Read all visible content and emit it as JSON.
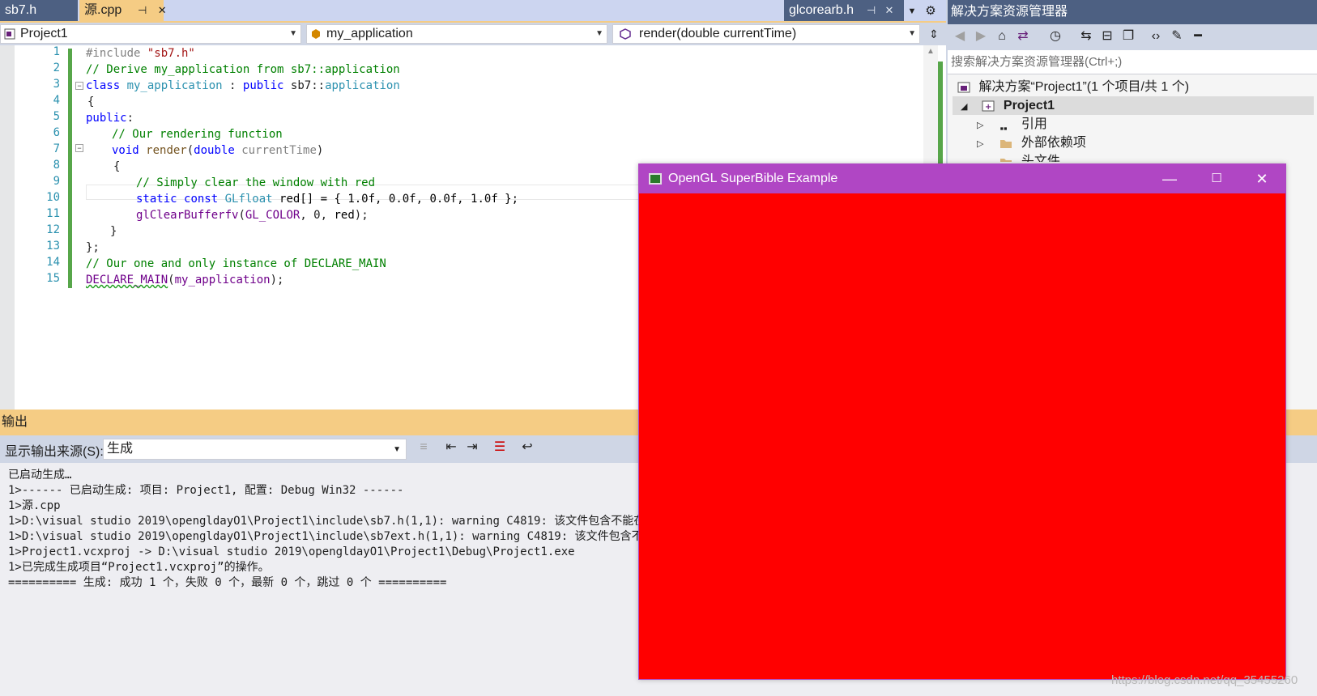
{
  "editor_tabs": {
    "tab1": "sb7.h",
    "tab2": "源.cpp",
    "tab3": "glcorearb.h"
  },
  "navbar": {
    "project": "Project1",
    "scope": "my_application",
    "member": "render(double currentTime)"
  },
  "code": {
    "line_numbers": [
      "1",
      "2",
      "3",
      "4",
      "5",
      "6",
      "7",
      "8",
      "9",
      "10",
      "11",
      "12",
      "13",
      "14",
      "15"
    ],
    "l1_directive": "#include ",
    "l1_string": "\"sb7.h\"",
    "l2": "// Derive my_application from sb7::application",
    "l3_kw": "class ",
    "l3_cls": "my_application",
    "l3_sep": " : ",
    "l3_pub": "public ",
    "l3_ns": "sb7::",
    "l3_base": "application",
    "l4": "{",
    "l5_kw": "public",
    "l5_colon": ":",
    "l6": "// Our rendering function",
    "l7_void": "void ",
    "l7_fn": "render",
    "l7_open": "(",
    "l7_double": "double ",
    "l7_param": "currentTime",
    "l7_close": ")",
    "l8": "{",
    "l9": "// Simply clear the window with red",
    "l10_static": "static ",
    "l10_const": "const ",
    "l10_type": "GLfloat ",
    "l10_rest": "red[] = { 1.0f, 0.0f, 0.0f, 1.0f };",
    "l11_fn": "glClearBufferfv",
    "l11_open": "(",
    "l11_macro": "GL_COLOR",
    "l11_mid": ", 0, ",
    "l11_red": "red",
    "l11_end": ");",
    "l12": "}",
    "l13": "};",
    "l14": "// Our one and only instance of DECLARE_MAIN",
    "l15_macro": "DECLARE_MAIN",
    "l15_open": "(",
    "l15_arg": "my_application",
    "l15_end": ");"
  },
  "solution_explorer": {
    "title": "解决方案资源管理器",
    "search_placeholder": "搜索解决方案资源管理器(Ctrl+;)",
    "solution": "解决方案“Project1”(1 个项目/共 1 个)",
    "project": "Project1",
    "references": "引用",
    "external_deps": "外部依赖项",
    "header_files": "头文件"
  },
  "output": {
    "title": "输出",
    "source_label": "显示输出来源(S):",
    "source_value": "生成",
    "lines": [
      "已启动生成…",
      "1>------ 已启动生成: 项目: Project1, 配置: Debug Win32 ------",
      "1>源.cpp",
      "1>D:\\visual studio 2019\\opengldayO1\\Project1\\include\\sb7.h(1,1): warning C4819: 该文件包含不能在当",
      "1>D:\\visual studio 2019\\opengldayO1\\Project1\\include\\sb7ext.h(1,1): warning C4819: 该文件包含不能在",
      "1>Project1.vcxproj -> D:\\visual studio 2019\\opengldayO1\\Project1\\Debug\\Project1.exe",
      "1>已完成生成项目“Project1.vcxproj”的操作。",
      "========== 生成: 成功 1 个，失败 0 个，最新 0 个，跳过 0 个 =========="
    ]
  },
  "gl_window": {
    "title": "OpenGL SuperBible Example",
    "clear_color": "#ff0000"
  },
  "watermark": "https://blog.csdn.net/qq_35455260",
  "colors": {
    "tab_active": "#f5cc84",
    "tab_inactive": "#4d6082",
    "gl_titlebar": "#b046c4"
  }
}
